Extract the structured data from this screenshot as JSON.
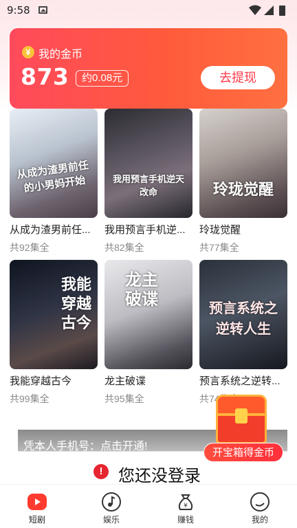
{
  "status_bar": {
    "time": "9:58"
  },
  "coin_card": {
    "title": "我的金币",
    "coin_symbol": "¥",
    "amount": "873",
    "approx_value": "约0.08元",
    "withdraw_label": "去提现"
  },
  "dramas": [
    {
      "title": "从成为渣男前任...",
      "episodes": "共92集全",
      "poster_text": "从成为渣男前任的小男妈开始"
    },
    {
      "title": "我用预言手机逆...",
      "episodes": "共82集全",
      "poster_text": "我用预言手机逆天改命"
    },
    {
      "title": "玲珑觉醒",
      "episodes": "共77集全",
      "poster_text": "玲珑觉醒"
    },
    {
      "title": "我能穿越古今",
      "episodes": "共99集全",
      "poster_text": "我能穿越古今"
    },
    {
      "title": "龙主破谍",
      "episodes": "共95集全",
      "poster_text": "龙主破谍"
    },
    {
      "title": "预言系统之逆转...",
      "episodes": "共74集全",
      "poster_text": "预言系统之逆转人生"
    }
  ],
  "promo": {
    "phone_text": "凭本人手机号：点击开通!",
    "login_text": "您还没登录"
  },
  "treasure": {
    "label": "开宝箱得金币"
  },
  "tabs": [
    {
      "label": "短剧",
      "icon": "play-icon",
      "active": true
    },
    {
      "label": "娱乐",
      "icon": "music-icon",
      "active": false
    },
    {
      "label": "赚钱",
      "icon": "money-bag-icon",
      "active": false
    },
    {
      "label": "我的",
      "icon": "profile-icon",
      "active": false
    }
  ],
  "colors": {
    "accent": "#ff3b4a",
    "tab_active": "#ff3b2f"
  }
}
